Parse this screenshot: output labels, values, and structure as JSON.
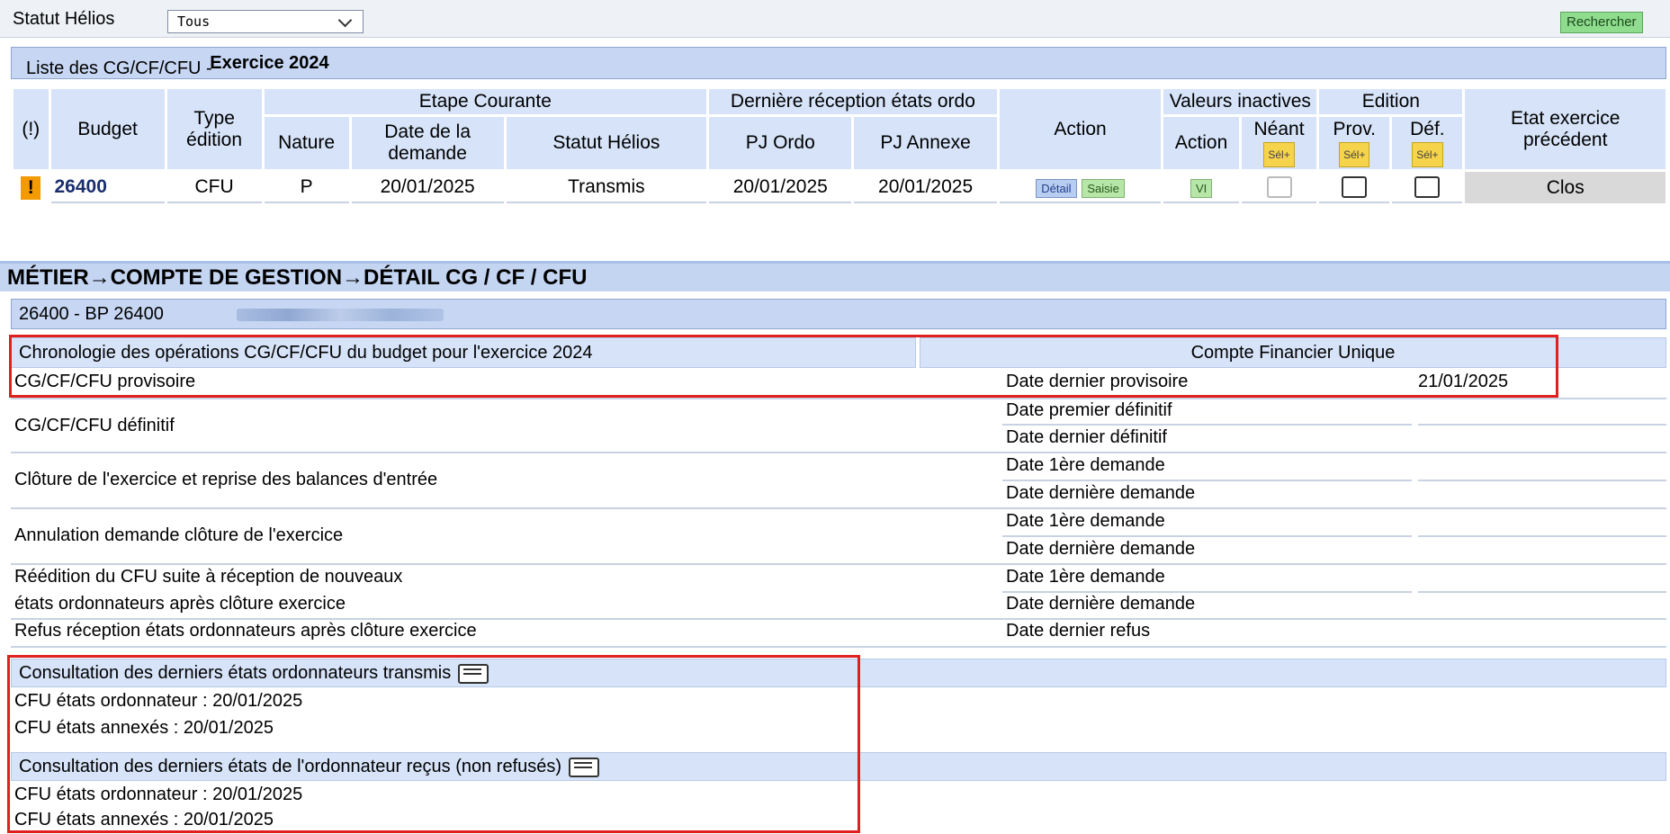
{
  "filter": {
    "label": "Statut Hélios",
    "select_value": "Tous",
    "search_button": "Rechercher"
  },
  "list": {
    "title_prefix": "Liste des CG/CF/CFU - ",
    "title_year": "Exercice 2024",
    "headers": {
      "alert": "(!)",
      "budget": "Budget",
      "type_edition": "Type édition",
      "etape_courante": "Etape Courante",
      "nature": "Nature",
      "date_demande": "Date de la demande",
      "statut_helios": "Statut Hélios",
      "derniere_reception": "Dernière réception états ordo",
      "pj_ordo": "PJ Ordo",
      "pj_annexe": "PJ Annexe",
      "action": "Action",
      "valeurs_inactives": "Valeurs inactives",
      "vi_action": "Action",
      "neant": "Néant",
      "edition": "Edition",
      "prov": "Prov.",
      "def": "Déf.",
      "etat_exercice": "Etat exercice précédent",
      "sel": "Sél+"
    },
    "row": {
      "alert": "!",
      "budget": "26400",
      "type_edition": "CFU",
      "nature": "P",
      "date_demande": "20/01/2025",
      "statut_helios": "Transmis",
      "pj_ordo": "20/01/2025",
      "pj_annexe": "20/01/2025",
      "btn_detail": "Détail",
      "btn_saisie": "Saisie",
      "btn_vi": "VI",
      "etat_exercice": "Clos"
    }
  },
  "detail": {
    "breadcrumb": "MÉTIER→COMPTE DE GESTION→DÉTAIL CG / CF / CFU",
    "budget_label": "26400 - BP 26400",
    "chronologie_header": "Chronologie des opérations CG/CF/CFU du budget pour l'exercice 2024",
    "compte_header": "Compte Financier Unique",
    "rows": {
      "provisoire": "CG/CF/CFU provisoire",
      "definitif": "CG/CF/CFU définitif",
      "cloture": "Clôture de l'exercice et reprise des balances d'entrée",
      "annulation": "Annulation demande clôture de l'exercice",
      "reedition_1": "Réédition du CFU suite à réception de nouveaux",
      "reedition_2": "états ordonnateurs après clôture exercice",
      "refus": "Refus réception états ordonnateurs après clôture exercice"
    },
    "dates": {
      "dernier_provisoire": "Date dernier provisoire",
      "dernier_provisoire_val": "21/01/2025",
      "premier_definitif": "Date premier définitif",
      "dernier_definitif": "Date dernier définitif",
      "premiere_demande": "Date 1ère demande",
      "derniere_demande": "Date dernière demande",
      "dernier_refus": "Date dernier refus"
    },
    "consultation_transmis": {
      "title": "Consultation des derniers états ordonnateurs transmis",
      "line1": "CFU états ordonnateur : 20/01/2025",
      "line2": "CFU états annexés : 20/01/2025"
    },
    "consultation_recus": {
      "title": "Consultation des derniers états de l'ordonnateur reçus (non refusés)",
      "line1": "CFU états ordonnateur : 20/01/2025",
      "line2": "CFU états annexés : 20/01/2025"
    }
  },
  "icons": {
    "chevron": "chevron-down-icon",
    "document": "document-icon",
    "alert": "alert-icon"
  },
  "colors": {
    "header_blue": "#c7d7f3",
    "highlight_red": "#e02020",
    "alert_orange": "#f29a00",
    "button_green": "#8fdc8f"
  }
}
